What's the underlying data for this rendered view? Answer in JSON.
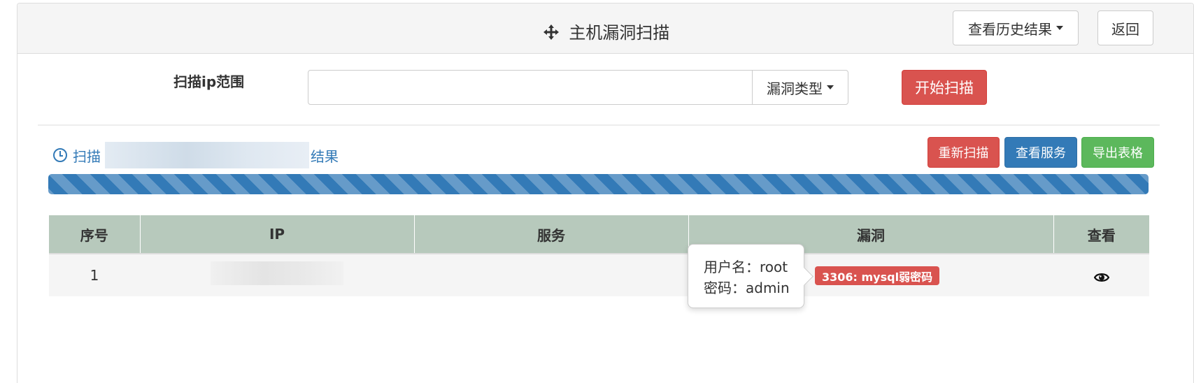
{
  "header": {
    "title": "主机漏洞扫描",
    "title_icon": "crosshair-move-icon",
    "history_label": "查看历史结果",
    "back_label": "返回"
  },
  "scan_form": {
    "range_label": "扫描ip范围",
    "ip_input_value": "",
    "vuln_type_label": "漏洞类型",
    "start_label": "开始扫描"
  },
  "result": {
    "prefix": "扫描",
    "suffix": "结果",
    "icon": "clock-icon",
    "rescan_label": "重新扫描",
    "services_label": "查看服务",
    "export_label": "导出表格",
    "progress_percent": 100
  },
  "table": {
    "headers": [
      "序号",
      "IP",
      "服务",
      "漏洞",
      "查看"
    ],
    "rows": [
      {
        "index": "1",
        "ip": "",
        "service": "",
        "vuln": "3306: mysql弱密码",
        "view_icon": "eye-icon"
      }
    ]
  },
  "tooltip": {
    "line1": "用户名：root",
    "line2": "密码：admin"
  },
  "colors": {
    "danger": "#d9534f",
    "primary": "#337ab7",
    "success": "#5cb85c",
    "table_header": "#b7c9bc"
  }
}
